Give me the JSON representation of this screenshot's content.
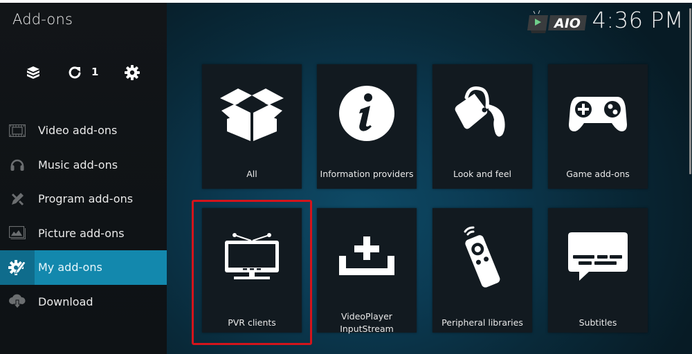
{
  "header": {
    "title": "Add-ons",
    "clock": "4:36 PM",
    "logo_text": "AIO"
  },
  "toolbar": {
    "icons": [
      {
        "name": "addon-box-icon"
      },
      {
        "name": "refresh-icon",
        "count": "1"
      },
      {
        "name": "settings-gear-icon"
      }
    ]
  },
  "sidebar": {
    "items": [
      {
        "label": "Video add-ons",
        "icon": "film-strip-icon",
        "active": false
      },
      {
        "label": "Music add-ons",
        "icon": "headphones-icon",
        "active": false
      },
      {
        "label": "Program add-ons",
        "icon": "pencil-wrench-icon",
        "active": false
      },
      {
        "label": "Picture add-ons",
        "icon": "picture-icon",
        "active": false
      },
      {
        "label": "My add-ons",
        "icon": "gear-pencil-icon",
        "active": true
      },
      {
        "label": "Download",
        "icon": "cloud-download-icon",
        "active": false
      }
    ]
  },
  "tiles": [
    {
      "label": "All",
      "icon": "open-box-icon"
    },
    {
      "label": "Information providers",
      "icon": "info-icon"
    },
    {
      "label": "Look and feel",
      "icon": "paint-bucket-icon"
    },
    {
      "label": "Game add-ons",
      "icon": "gamepad-icon"
    },
    {
      "label": "PVR clients",
      "icon": "tv-icon",
      "highlighted": true
    },
    {
      "label_line1": "VideoPlayer",
      "label_line2": "InputStream",
      "icon": "add-input-icon"
    },
    {
      "label": "Peripheral libraries",
      "icon": "remote-control-icon"
    },
    {
      "label": "Subtitles",
      "icon": "subtitles-bubble-icon"
    }
  ],
  "colors": {
    "accent": "#1388ad",
    "highlight_box": "#d4141b",
    "tile_bg": "#121a20"
  }
}
